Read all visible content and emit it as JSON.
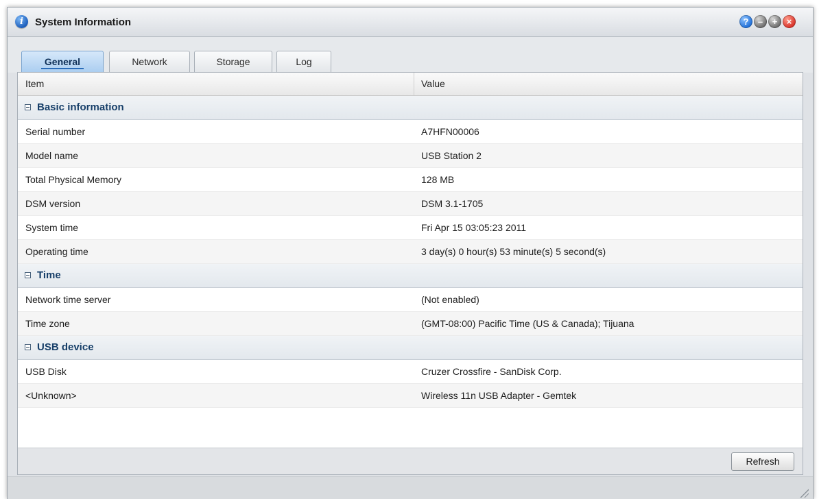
{
  "window": {
    "title": "System Information",
    "app_icon": "info-icon",
    "controls": [
      "help-icon",
      "minimize-icon",
      "maximize-icon",
      "close-icon"
    ]
  },
  "tabs": [
    {
      "label": "General",
      "active": true
    },
    {
      "label": "Network",
      "active": false
    },
    {
      "label": "Storage",
      "active": false
    },
    {
      "label": "Log",
      "active": false
    }
  ],
  "grid": {
    "columns": {
      "item": "Item",
      "value": "Value"
    },
    "groups": [
      {
        "label": "Basic information",
        "rows": [
          {
            "item": "Serial number",
            "value": "A7HFN00006"
          },
          {
            "item": "Model name",
            "value": "USB Station 2"
          },
          {
            "item": "Total Physical Memory",
            "value": "128 MB"
          },
          {
            "item": "DSM version",
            "value": "DSM 3.1-1705"
          },
          {
            "item": "System time",
            "value": "Fri Apr 15 03:05:23 2011"
          },
          {
            "item": "Operating time",
            "value": "3 day(s) 0 hour(s) 53 minute(s) 5 second(s)"
          }
        ]
      },
      {
        "label": "Time",
        "rows": [
          {
            "item": "Network time server",
            "value": "(Not enabled)"
          },
          {
            "item": "Time zone",
            "value": "(GMT-08:00) Pacific Time (US & Canada); Tijuana"
          }
        ]
      },
      {
        "label": "USB device",
        "rows": [
          {
            "item": "USB Disk",
            "value": "Cruzer Crossfire - SanDisk Corp."
          },
          {
            "item": "<Unknown>",
            "value": "Wireless 11n USB Adapter - Gemtek"
          }
        ]
      }
    ]
  },
  "footer": {
    "refresh_label": "Refresh"
  },
  "colors": {
    "accent": "#2b6cb8",
    "group_text": "#173f69"
  }
}
